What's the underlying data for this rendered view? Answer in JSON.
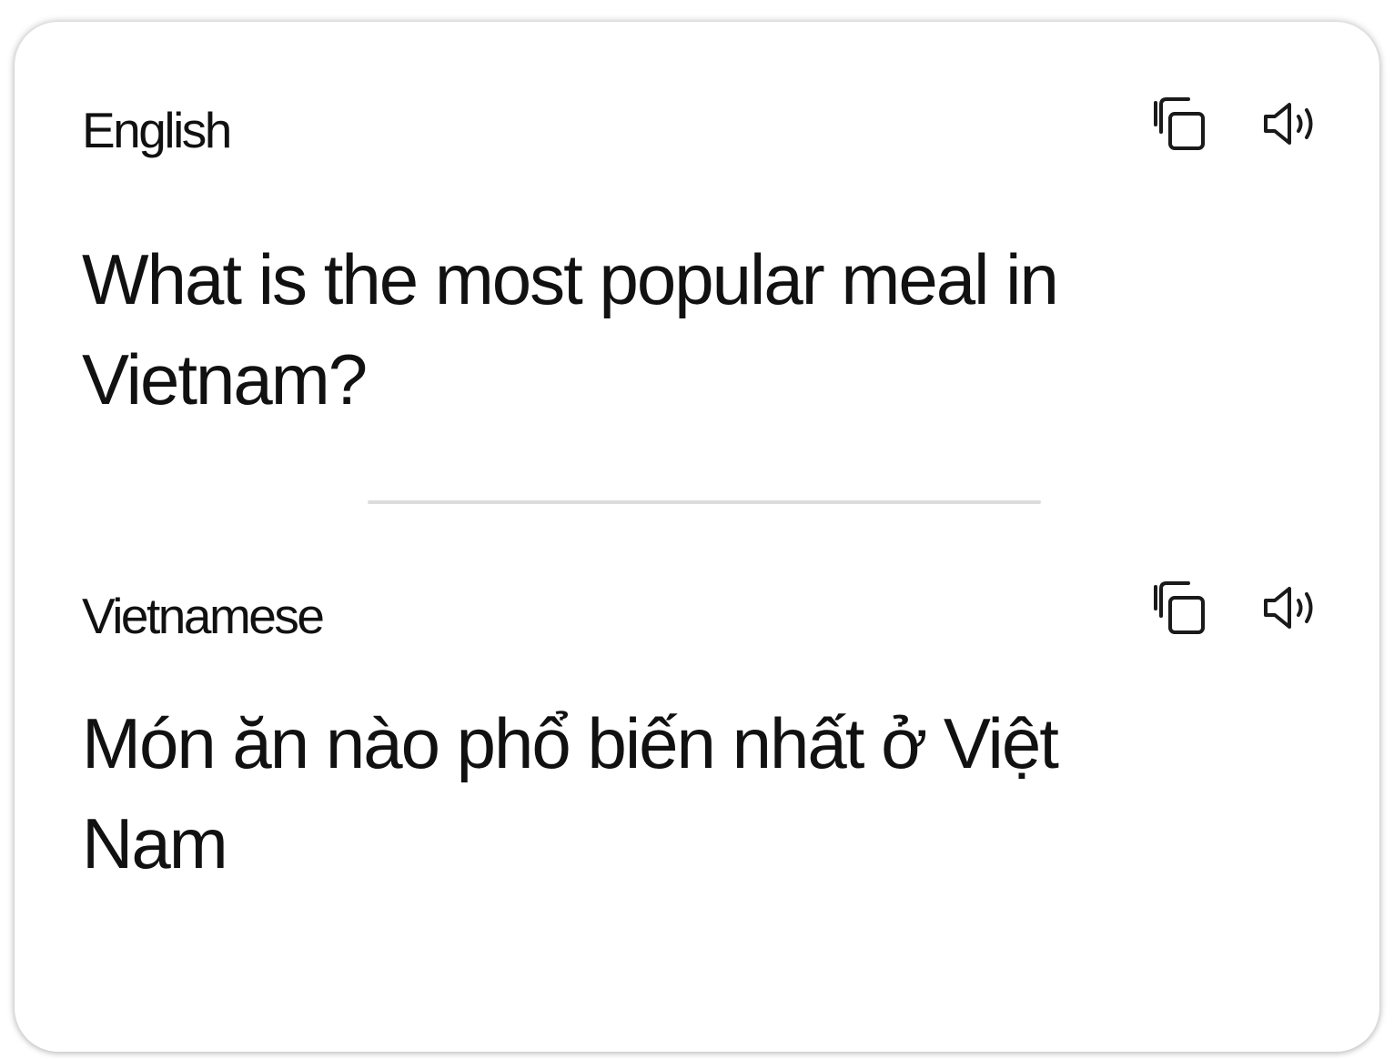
{
  "source": {
    "language": "English",
    "text": "What is the most popular meal in Vietnam?",
    "actions": [
      {
        "icon": "copy-icon"
      },
      {
        "icon": "speaker-icon"
      }
    ]
  },
  "target": {
    "language": "Vietnamese",
    "text": "Món ăn nào phổ biến nhất ở Việt Nam",
    "actions": [
      {
        "icon": "copy-icon"
      },
      {
        "icon": "speaker-icon"
      }
    ]
  },
  "colors": {
    "text": "#111111",
    "card_background": "#ffffff",
    "divider": "#dcdcdc"
  }
}
